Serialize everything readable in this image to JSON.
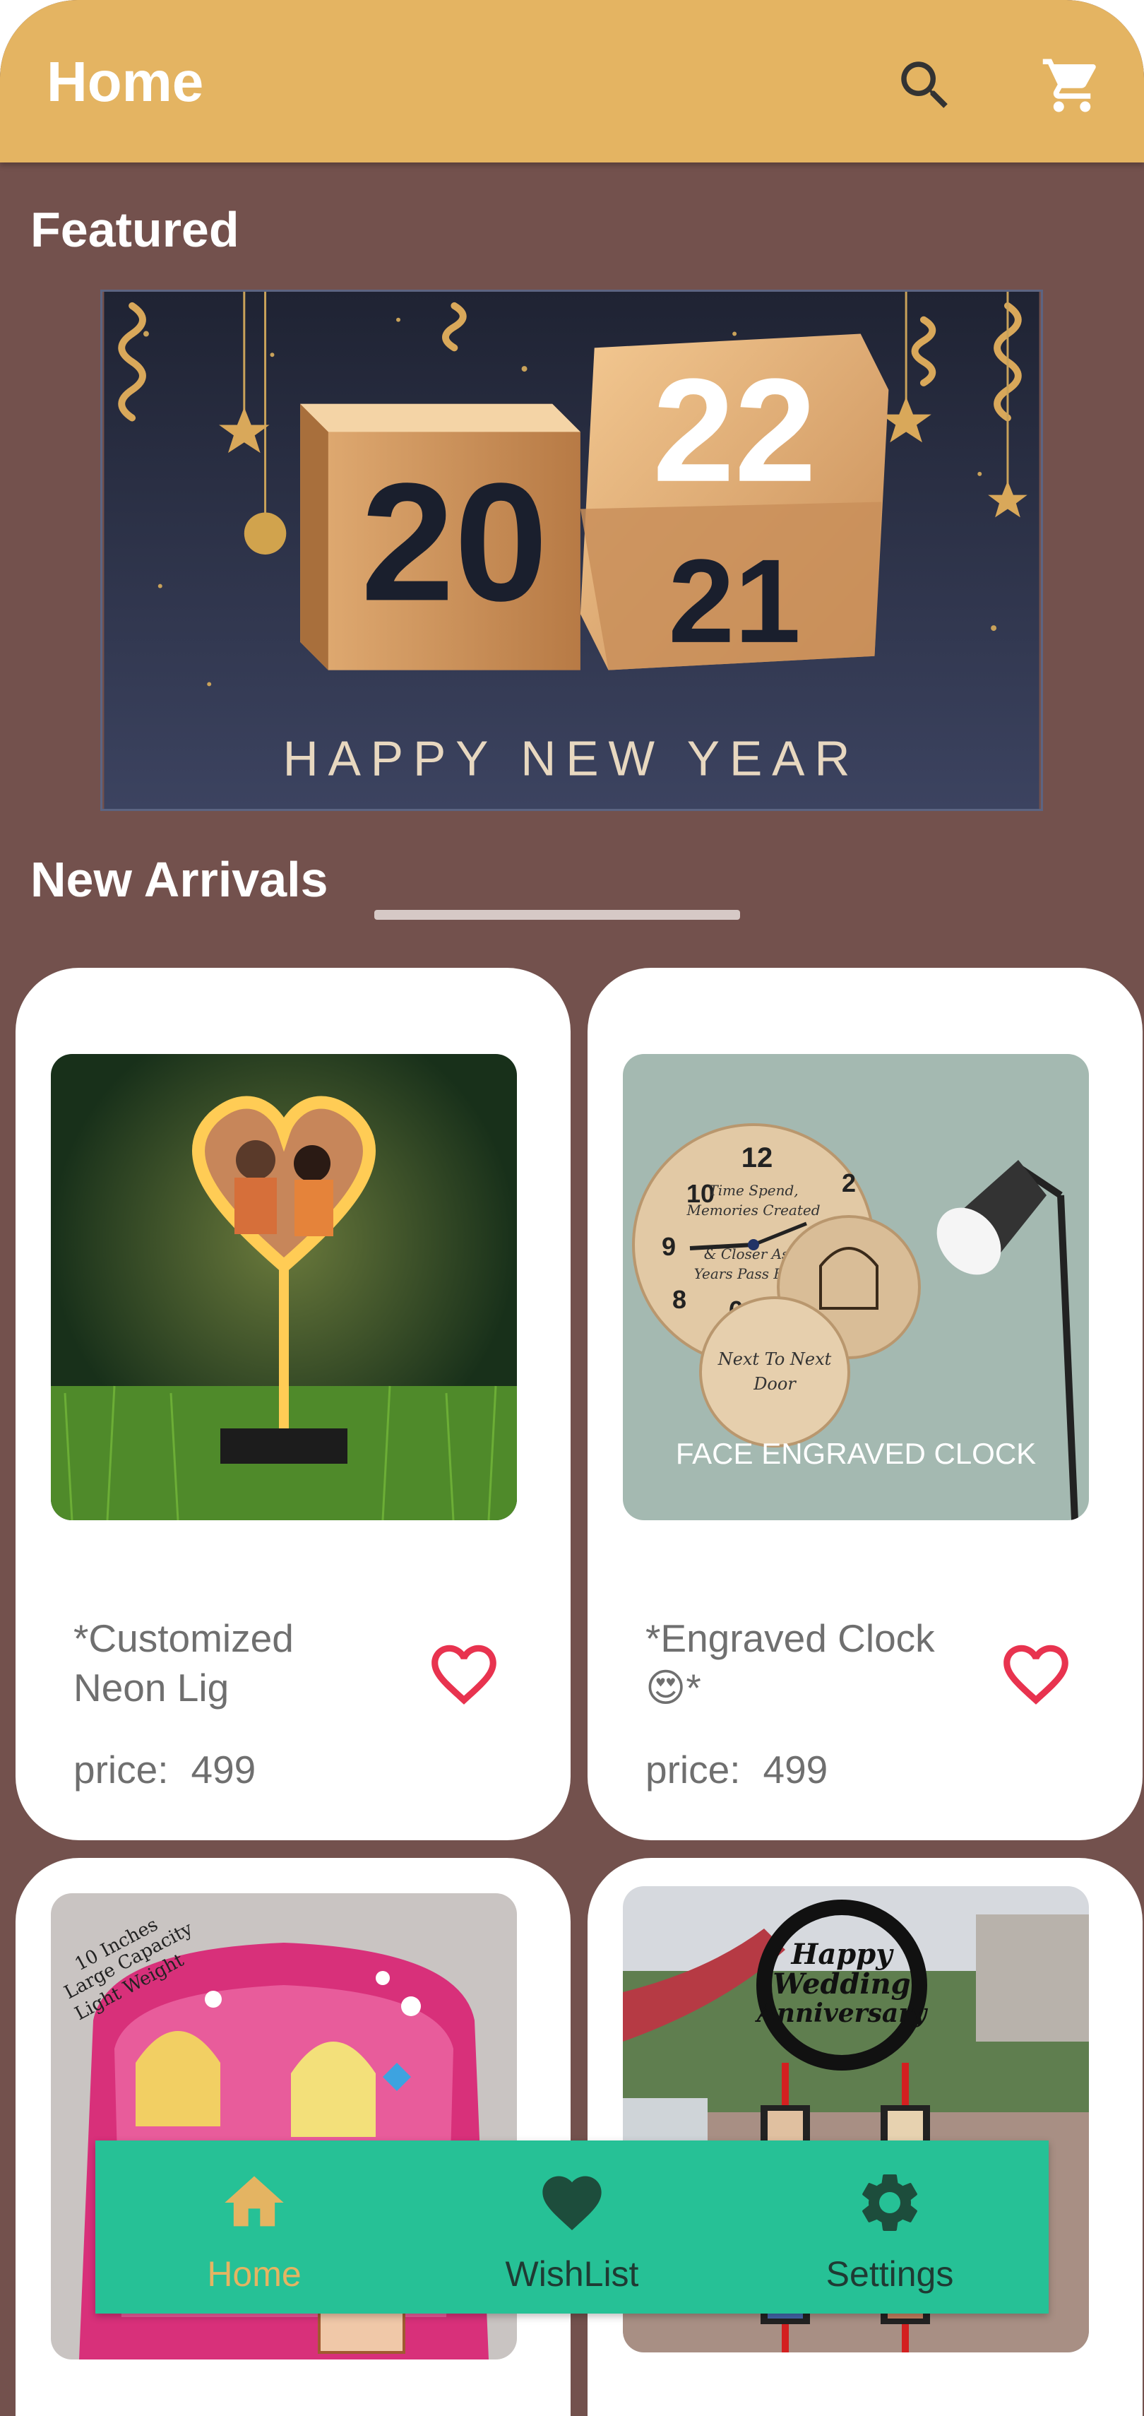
{
  "appbar": {
    "title": "Home",
    "color": "#e4b462",
    "search_icon": "search-icon",
    "cart_icon": "shopping-cart-icon"
  },
  "featured": {
    "title": "Featured",
    "banner": {
      "top_number": "22",
      "left_number": "20",
      "bottom_number": "21",
      "caption": "HAPPY NEW YEAR"
    }
  },
  "new_arrivals": {
    "title": "New Arrivals",
    "products": [
      {
        "name": "*Customized Neon Lig",
        "price_label": "price:",
        "price": "499",
        "wishlist_icon": "heart-outline-icon"
      },
      {
        "name": "*Engraved Clock 😍*",
        "price_label": "price:",
        "price": "499",
        "wishlist_icon": "heart-outline-icon",
        "image_text": {
          "caption": "FACE ENGRAVED CLOCK",
          "line1": "Time Spend,",
          "line2": "Memories Created",
          "line3": "& Closer As",
          "line4": "Years Pass By..",
          "bottom1": "Next To Next",
          "bottom2": "Door"
        }
      },
      {
        "image_text": {
          "line1": "10 Inches",
          "line2": "Large Capacity",
          "line3": "Light Weight"
        }
      },
      {
        "image_text": {
          "line1": "Happy",
          "line2": "Wedding",
          "line3": "Anniversary"
        }
      }
    ]
  },
  "bottom_nav": {
    "background": "#26c196",
    "active_color": "#e4b462",
    "items": [
      {
        "label": "Home",
        "icon": "home-icon",
        "active": true
      },
      {
        "label": "WishList",
        "icon": "heart-icon",
        "active": false
      },
      {
        "label": "Settings",
        "icon": "gear-icon",
        "active": false
      }
    ]
  }
}
